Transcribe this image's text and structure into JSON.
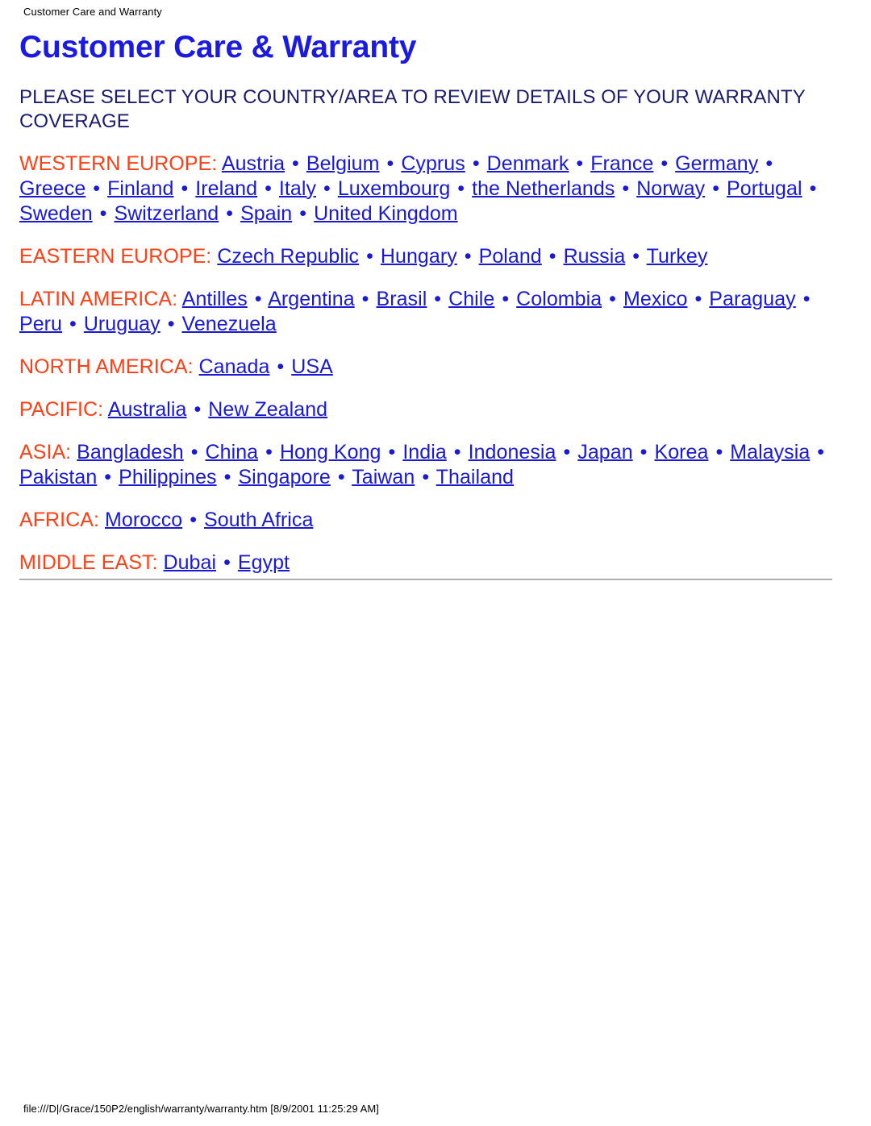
{
  "print_header": "Customer Care and Warranty",
  "print_footer": "file:///D|/Grace/150P2/english/warranty/warranty.htm [8/9/2001 11:25:29 AM]",
  "page_title": "Customer Care & Warranty",
  "intro": "PLEASE SELECT YOUR COUNTRY/AREA TO REVIEW DETAILS OF YOUR WARRANTY COVERAGE",
  "separator": "•",
  "colors": {
    "title_blue": "#1a1ae0",
    "intro_navy": "#1b1b6e",
    "region_label_orange": "#ff4016",
    "link_blue": "#1a1ad2",
    "rule_gray": "#a9a9a9",
    "background": "#ffffff"
  },
  "regions": [
    {
      "label": "WESTERN EUROPE:",
      "countries": [
        "Austria",
        "Belgium",
        "Cyprus",
        "Denmark",
        "France",
        "Germany",
        "Greece",
        "Finland",
        "Ireland",
        "Italy",
        "Luxembourg",
        "the Netherlands",
        "Norway",
        "Portugal",
        "Sweden",
        "Switzerland",
        "Spain",
        "United Kingdom"
      ]
    },
    {
      "label": "EASTERN EUROPE:",
      "countries": [
        "Czech Republic",
        "Hungary",
        "Poland",
        "Russia",
        "Turkey"
      ]
    },
    {
      "label": "LATIN AMERICA:",
      "countries": [
        "Antilles",
        "Argentina",
        "Brasil",
        "Chile",
        "Colombia",
        "Mexico",
        "Paraguay",
        "Peru",
        "Uruguay",
        "Venezuela"
      ]
    },
    {
      "label": "NORTH AMERICA:",
      "countries": [
        "Canada",
        "USA"
      ]
    },
    {
      "label": "PACIFIC:",
      "countries": [
        "Australia",
        "New Zealand"
      ]
    },
    {
      "label": "ASIA:",
      "countries": [
        "Bangladesh",
        "China",
        "Hong Kong",
        "India",
        "Indonesia",
        "Japan",
        "Korea",
        "Malaysia",
        "Pakistan",
        "Philippines",
        "Singapore",
        "Taiwan",
        "Thailand"
      ]
    },
    {
      "label": "AFRICA:",
      "countries": [
        "Morocco",
        "South Africa"
      ]
    },
    {
      "label": "MIDDLE EAST:",
      "countries": [
        "Dubai",
        "Egypt"
      ]
    }
  ]
}
